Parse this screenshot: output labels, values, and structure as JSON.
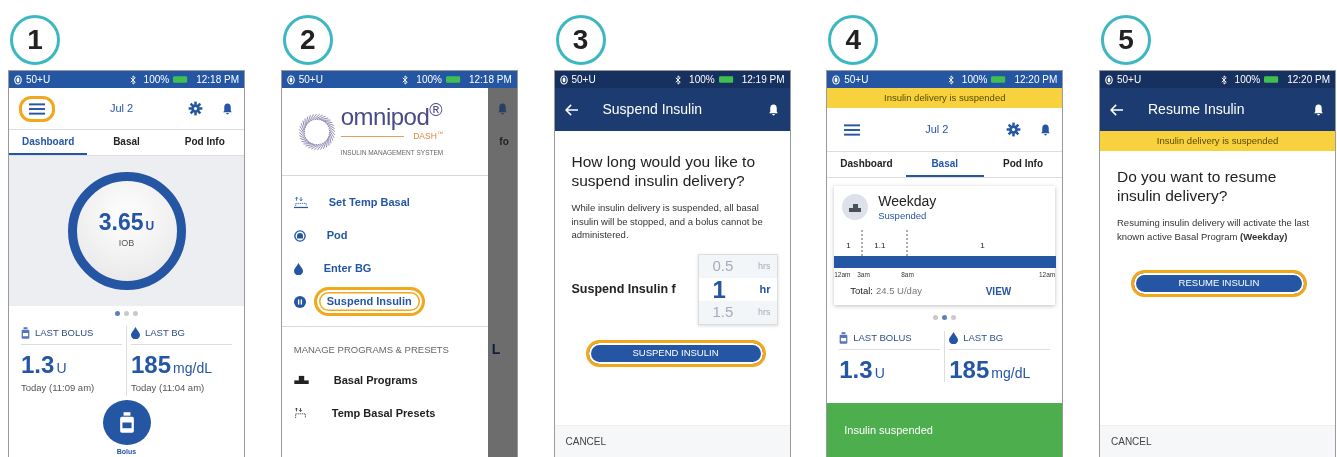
{
  "screens": [
    {
      "kind": "dashboard",
      "step": "1",
      "status": {
        "reservoir": "50+U",
        "battery": "100%",
        "time": "12:18 PM"
      },
      "header": {
        "date": "Jul 2",
        "menu_highlighted": true
      },
      "tabs": [
        {
          "label": "Dashboard",
          "selected": true
        },
        {
          "label": "Basal",
          "selected": false
        },
        {
          "label": "Pod Info",
          "selected": false
        }
      ],
      "panel": {
        "kind": "iob",
        "value": "3.65",
        "unit": "U",
        "label": "IOB"
      },
      "pager": [
        {
          "selected": true
        },
        {
          "selected": false
        },
        {
          "selected": false
        }
      ],
      "stats": [
        {
          "label": "LAST BOLUS",
          "value": "1.3",
          "unit": "U",
          "time": "Today (11:09 am)"
        },
        {
          "label": "LAST BG",
          "value": "185",
          "unit": "mg/dL",
          "time": "Today (11:04 am)"
        }
      ],
      "bolus_label": "Bolus"
    },
    {
      "kind": "menu",
      "step": "2",
      "status": {
        "reservoir": "50+U",
        "battery": "100%",
        "time": "12:18 PM"
      },
      "logo": {
        "name": "omnipod$^{®}$",
        "product": "DASH$^{™}$",
        "tagline": "INSULIN MANAGEMENT SYSTEM"
      },
      "items": [
        {
          "label": "Set Temp Basal",
          "highlighted": false
        },
        {
          "label": "Pod",
          "highlighted": false
        },
        {
          "label": "Enter BG",
          "highlighted": false
        },
        {
          "label": "Suspend Insulin",
          "highlighted": true
        }
      ],
      "section": "MANAGE PROGRAMS & PRESETS",
      "section_items": [
        {
          "label": "Basal Programs"
        },
        {
          "label": "Temp Basal Presets"
        }
      ],
      "background": [
        "fo",
        "L"
      ]
    },
    {
      "kind": "suspend",
      "step": "3",
      "status": {
        "reservoir": "50+U",
        "battery": "100%",
        "time": "12:19 PM"
      },
      "title": "Suspend Insulin",
      "question": "How long would you like to suspend insulin delivery?",
      "note": "While insulin delivery is suspended, all basal insulin will be stopped, and a bolus cannot be administered.",
      "duration_label": "Suspend Insulin f",
      "picker": [
        {
          "value": "0.5",
          "unit": "hrs",
          "selected": false
        },
        {
          "value": "1",
          "unit": "hr",
          "selected": true
        },
        {
          "value": "1.5",
          "unit": "hrs",
          "selected": false
        }
      ],
      "button": {
        "label": "SUSPEND INSULIN",
        "highlighted": true
      },
      "cancel": "CANCEL"
    },
    {
      "kind": "dashboard",
      "step": "4",
      "status": {
        "reservoir": "50+U",
        "battery": "100%",
        "time": "12:20 PM"
      },
      "banner": "Insulin delivery is suspended",
      "header": {
        "date": "Jul 2",
        "menu_highlighted": false
      },
      "tabs": [
        {
          "label": "Dashboard",
          "selected": false
        },
        {
          "label": "Basal",
          "selected": true
        },
        {
          "label": "Pod Info",
          "selected": false
        }
      ],
      "panel": {
        "kind": "basal",
        "name": "Weekday",
        "state": "Suspended",
        "rate_labels": [
          "1",
          "1.1",
          "1"
        ],
        "time_labels": [
          "12am",
          "3am",
          "8am",
          "12am"
        ],
        "total_label": "Total:",
        "total": "24.5 U/day",
        "action": "VIEW"
      },
      "pager": [
        {
          "selected": false
        },
        {
          "selected": true
        },
        {
          "selected": false
        }
      ],
      "stats": [
        {
          "label": "LAST BOLUS",
          "value": "1.3",
          "unit": "U"
        },
        {
          "label": "LAST BG",
          "value": "185",
          "unit": "mg/dL"
        }
      ],
      "toast": "Insulin suspended"
    },
    {
      "kind": "resume",
      "step": "5",
      "status": {
        "reservoir": "50+U",
        "battery": "100%",
        "time": "12:20 PM"
      },
      "title": "Resume Insulin",
      "banner": "Insulin delivery is suspended",
      "question": "Do you want to resume insulin delivery?",
      "note": "Resuming insulin delivery will activate the last known active Basal Program **(Weekday)**",
      "button": {
        "label": "RESUME INSULIN",
        "highlighted": true
      },
      "cancel": "CANCEL"
    }
  ]
}
